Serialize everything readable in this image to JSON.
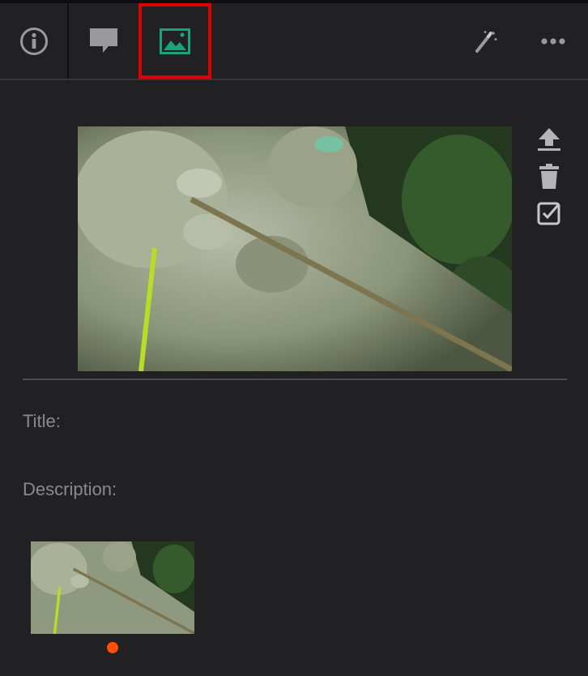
{
  "toolbar": {
    "tabs": [
      {
        "name": "info",
        "icon": "info-icon"
      },
      {
        "name": "comments",
        "icon": "speech-bubble-icon"
      },
      {
        "name": "image",
        "icon": "image-icon",
        "active": true
      },
      {
        "name": "magic",
        "icon": "magic-wand-icon"
      },
      {
        "name": "more",
        "icon": "more-dots-icon"
      }
    ],
    "active_color": "#1aa37a",
    "icon_color": "#9a9a9e",
    "highlight_color": "#e00000"
  },
  "image_actions": [
    {
      "name": "upload",
      "icon": "upload-icon"
    },
    {
      "name": "delete",
      "icon": "trash-icon"
    },
    {
      "name": "select",
      "icon": "checkbox-icon"
    }
  ],
  "fields": {
    "title_label": "Title:",
    "description_label": "Description:"
  },
  "thumbnails": {
    "count": 1,
    "selected_indicator_color": "#ff4e0a"
  }
}
